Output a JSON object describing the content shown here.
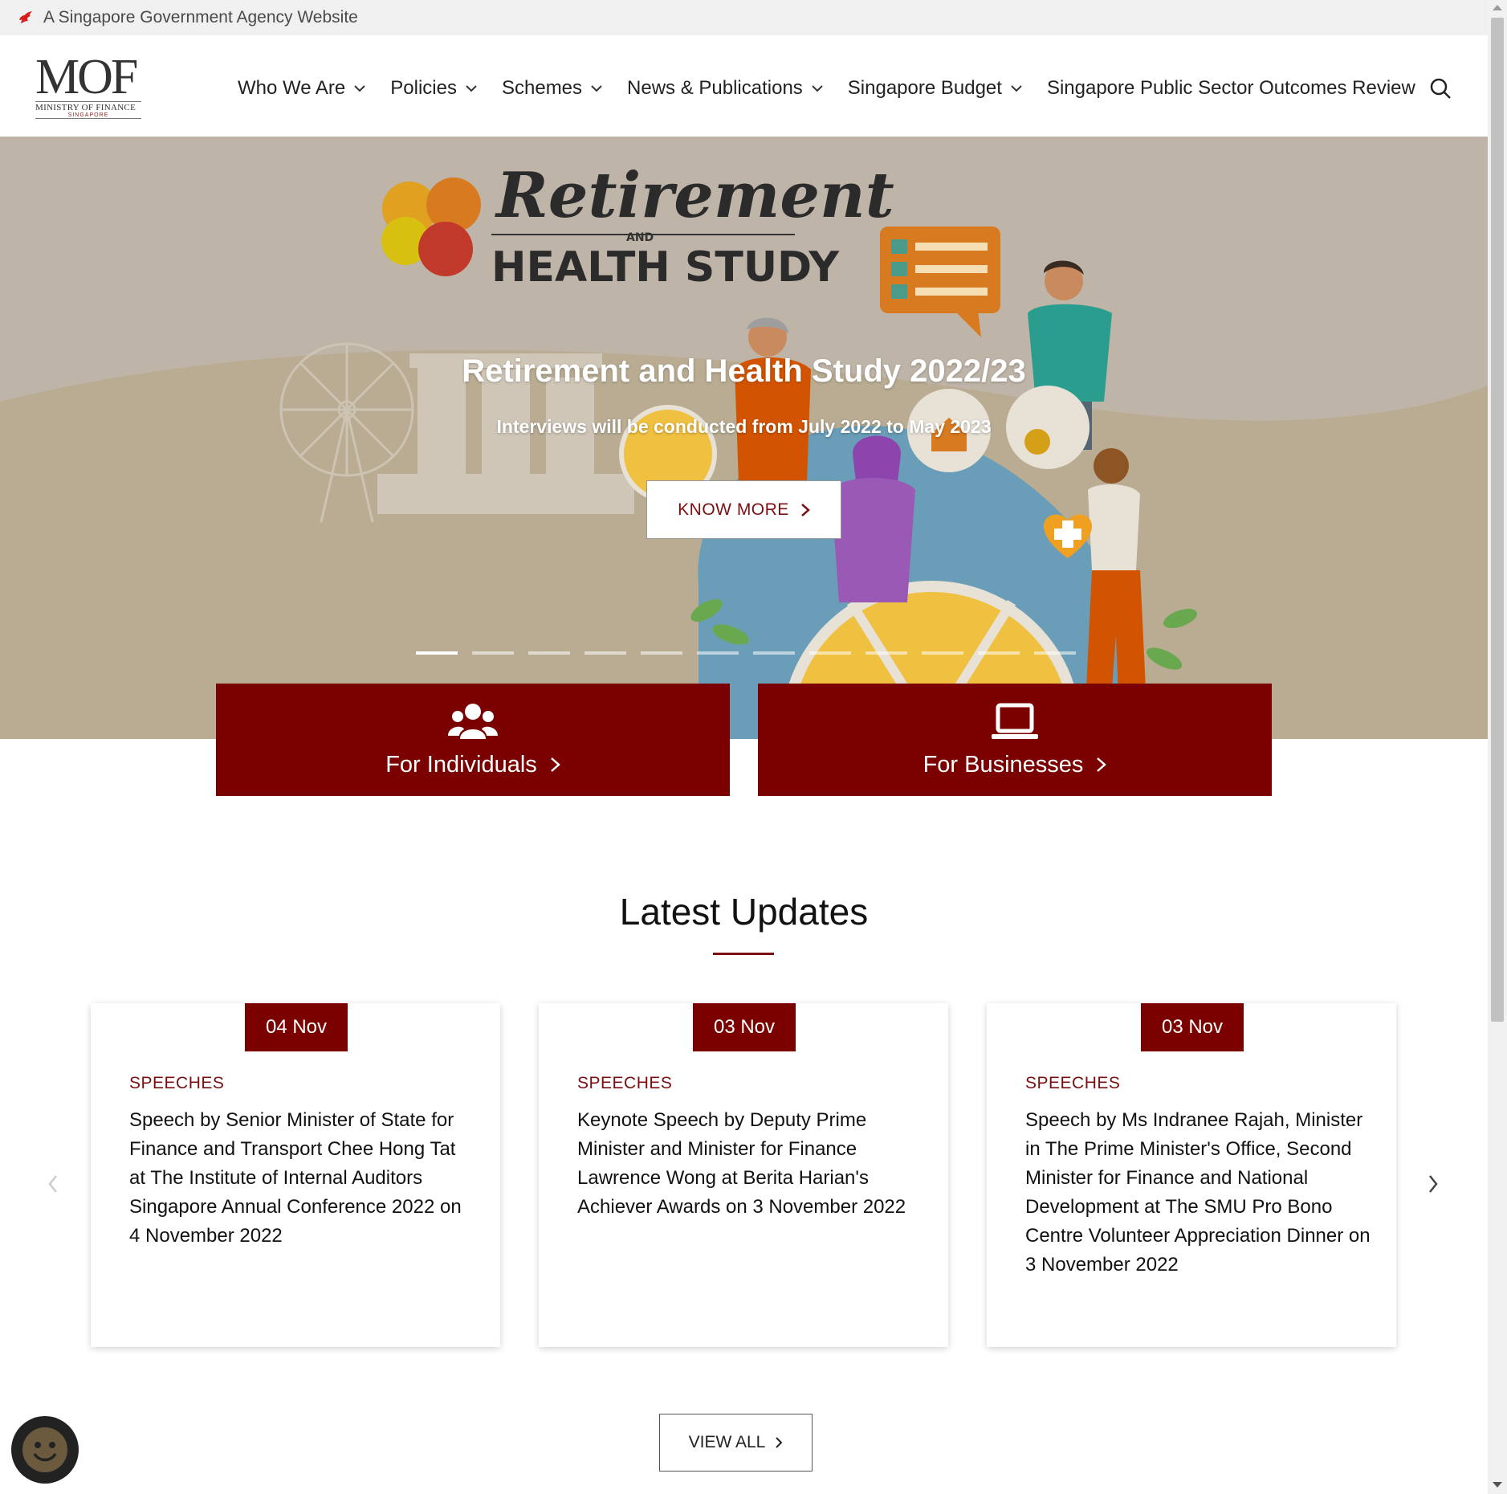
{
  "gov_banner": {
    "text": "A Singapore Government Agency Website"
  },
  "logo": {
    "mof": "MOF",
    "ministry": "MINISTRY OF FINANCE",
    "country": "SINGAPORE"
  },
  "nav": {
    "items": [
      {
        "label": "Who We Are",
        "has_dropdown": true
      },
      {
        "label": "Policies",
        "has_dropdown": true
      },
      {
        "label": "Schemes",
        "has_dropdown": true
      },
      {
        "label": "News & Publications",
        "has_dropdown": true
      },
      {
        "label": "Singapore Budget",
        "has_dropdown": true
      },
      {
        "label": "Singapore Public Sector Outcomes Review",
        "has_dropdown": false
      }
    ],
    "search_icon": "search-icon"
  },
  "hero": {
    "banner_title_script": "Retirement",
    "banner_title_and": "AND",
    "banner_title_block": "HEALTH STUDY",
    "title": "Retirement and Health Study 2022/23",
    "subtitle": "Interviews will be conducted from July 2022 to May 2023",
    "cta_label": "KNOW MORE",
    "slide_count": 12,
    "active_slide": 0
  },
  "audience": {
    "individuals": {
      "label": "For Individuals",
      "icon": "people-group-icon"
    },
    "businesses": {
      "label": "For Businesses",
      "icon": "laptop-icon"
    }
  },
  "updates": {
    "title": "Latest Updates",
    "cards": [
      {
        "date": "04 Nov",
        "category": "SPEECHES",
        "headline": "Speech by Senior Minister of State for Finance and Transport Chee Hong Tat at The Institute of Internal Auditors Singapore Annual Conference 2022 on 4 November 2022"
      },
      {
        "date": "03 Nov",
        "category": "SPEECHES",
        "headline": "Keynote Speech by Deputy Prime Minister and Minister for Finance Lawrence Wong at Berita Harian's Achiever Awards on 3 November 2022"
      },
      {
        "date": "03 Nov",
        "category": "SPEECHES",
        "headline": "Speech by Ms Indranee Rajah, Minister in The Prime Minister's Office, Second Minister for Finance and National Development at The SMU Pro Bono Centre Volunteer Appreciation Dinner on 3 November 2022"
      }
    ],
    "view_all_label": "VIEW ALL"
  },
  "colors": {
    "brand_red": "#7b0000",
    "accent_red": "#7b0f12",
    "hero_bg": "#bfb4a8"
  }
}
